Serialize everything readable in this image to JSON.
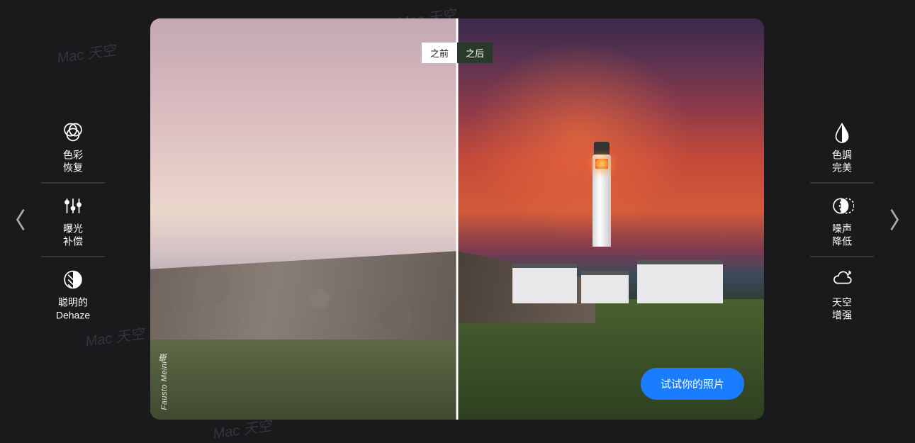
{
  "left_tools": [
    {
      "id": "color-restore",
      "label": "色彩\n恢复"
    },
    {
      "id": "exposure-comp",
      "label": "曝光\n补偿"
    },
    {
      "id": "smart-dehaze",
      "label": "聪明的\nDehaze"
    }
  ],
  "right_tools": [
    {
      "id": "tone-perfect",
      "label": "色調\n完美"
    },
    {
      "id": "noise-reduce",
      "label": "噪声\n降低"
    },
    {
      "id": "sky-enhance",
      "label": "天空\n增强"
    }
  ],
  "compare": {
    "before": "之前",
    "after": "之后"
  },
  "credit": "Fausto Meini摄",
  "cta": "试试你的照片",
  "watermark": "Mac 天空"
}
